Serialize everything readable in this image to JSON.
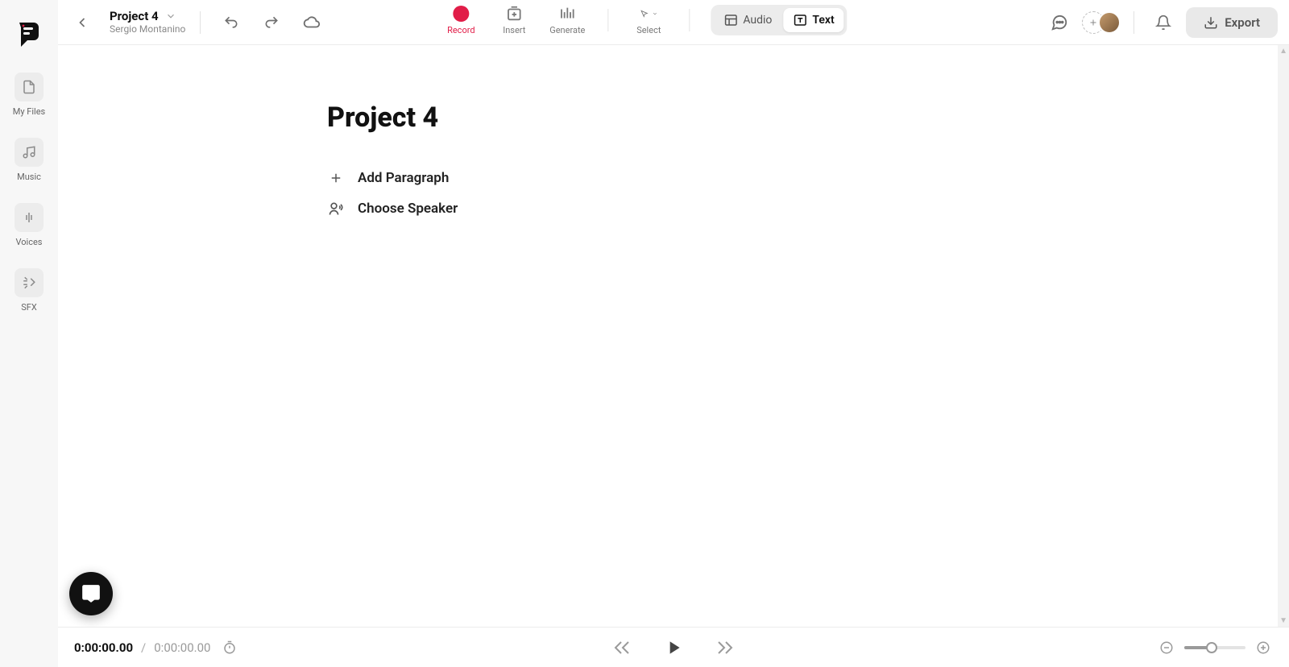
{
  "project": {
    "title": "Project 4",
    "owner": "Sergio Montanino"
  },
  "sidebar": {
    "items": [
      {
        "label": "My Files"
      },
      {
        "label": "Music"
      },
      {
        "label": "Voices"
      },
      {
        "label": "SFX"
      }
    ]
  },
  "toolbar": {
    "record": "Record",
    "insert": "Insert",
    "generate": "Generate",
    "select": "Select"
  },
  "mode": {
    "audio": "Audio",
    "text": "Text"
  },
  "export_label": "Export",
  "doc": {
    "heading": "Project 4",
    "add_paragraph": "Add Paragraph",
    "choose_speaker": "Choose Speaker"
  },
  "playbar": {
    "current": "0:00:00.00",
    "separator": "/",
    "total": "0:00:00.00"
  },
  "colors": {
    "accent_record": "#e11d48"
  }
}
